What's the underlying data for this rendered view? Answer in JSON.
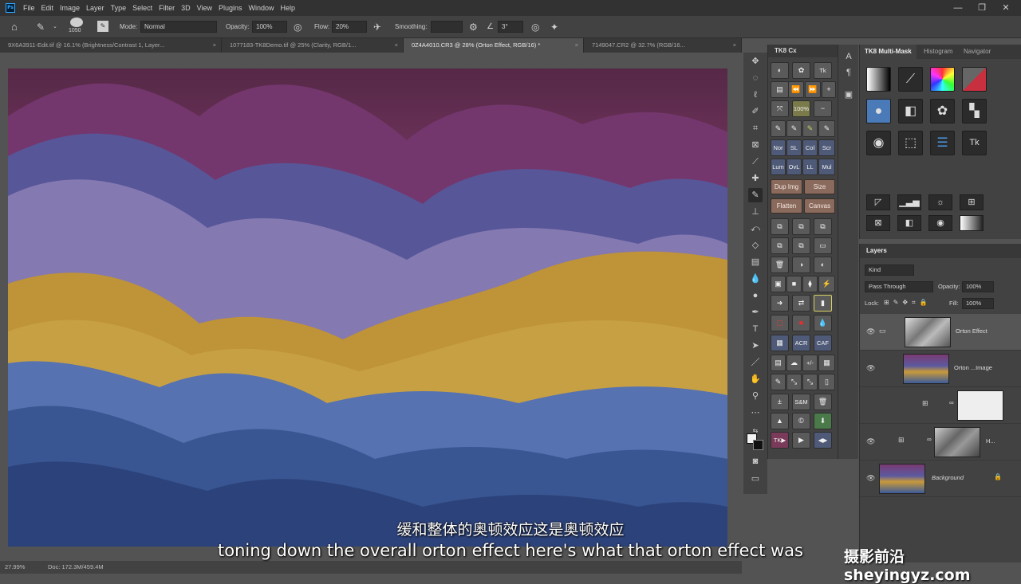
{
  "menu": {
    "app_icon": "Ps",
    "items": [
      "File",
      "Edit",
      "Image",
      "Layer",
      "Type",
      "Select",
      "Filter",
      "3D",
      "View",
      "Plugins",
      "Window",
      "Help"
    ],
    "window_controls": [
      "—",
      "❐",
      "✕"
    ]
  },
  "options": {
    "brush_size": "1050",
    "mode_label": "Mode:",
    "mode_value": "Normal",
    "opacity_label": "Opacity:",
    "opacity_value": "100%",
    "flow_label": "Flow:",
    "flow_value": "20%",
    "smoothing_label": "Smoothing:",
    "smoothing_value": "",
    "angle_value": "3°"
  },
  "tabs": [
    {
      "label": "9X6A3911-Edit.tif @ 16.1% (Brightness/Contrast 1, Layer...",
      "active": false
    },
    {
      "label": "1077183-TK8Demo.tif @ 25% (Clarity, RGB/1...",
      "active": false
    },
    {
      "label": "0Z4A4010.CR3 @ 28% (Orton Effect, RGB/16) *",
      "active": true
    },
    {
      "label": "7149047.CR2 @ 32.7% (RGB/16...",
      "active": false
    }
  ],
  "status": {
    "zoom": "27.99%",
    "doc": "Doc: 172.3M/459.4M"
  },
  "tk8": {
    "title": "TK8 Cx",
    "grid_rows": [
      [
        "◐",
        "✿",
        "Tk"
      ],
      [
        "▤",
        "⏪",
        "⏩",
        "+"
      ],
      [
        "⤧",
        "100%",
        "−"
      ],
      [
        "✎",
        "✎",
        "✎",
        "✎"
      ],
      [
        "Nor",
        "SL",
        "Col",
        "Scr"
      ],
      [
        "Lum",
        "OvL",
        "LL",
        "Mul"
      ],
      [
        "⧉",
        "⧉",
        "⧉"
      ],
      [
        "⧉",
        "⧉",
        "▭"
      ],
      [
        "🗑",
        "◑",
        "◐"
      ],
      [
        "▣",
        "■",
        "⧫",
        "⚡"
      ],
      [
        "➜",
        "⇄",
        "▮"
      ],
      [
        "▢",
        "■",
        "💧"
      ],
      [
        "▦",
        "ACR",
        "CAF"
      ],
      [
        "▤",
        "☁",
        "+/-",
        "▦"
      ],
      [
        "✎",
        "⤡",
        "⤡",
        "▯"
      ],
      [
        "±",
        "S&M",
        "🗑"
      ],
      [
        "▲",
        "©",
        "⬇"
      ],
      [
        "TK▶",
        "▶",
        "◀▶"
      ]
    ],
    "wide_buttons": [
      [
        "Dup Img",
        "Size"
      ],
      [
        "Flatten",
        "Canvas"
      ]
    ]
  },
  "multimask": {
    "tabs": [
      "TK8 Multi-Mask",
      "Histogram",
      "Navigator"
    ],
    "icons": [
      "gradient-bw-icon",
      "wand-mask-icon",
      "color-wheel-icon",
      "red-diagonal-icon",
      "person-mask-icon",
      "contrast-mask-icon",
      "flower-mask-icon",
      "checker-mask-icon",
      "dot-mask-icon",
      "selection-brush-icon",
      "list-icon",
      "tk-logo-icon"
    ],
    "small_icons": [
      "curves-icon",
      "levels-icon",
      "exposure-icon",
      "grid-icon",
      "mask-icon",
      "split-icon",
      "camera-icon",
      "gradient-icon"
    ]
  },
  "layers": {
    "title": "Layers",
    "kind": "Kind",
    "blend": "Pass Through",
    "opacity_label": "Opacity:",
    "opacity_value": "100%",
    "lock_label": "Lock:",
    "fill_label": "Fill:",
    "fill_value": "100%",
    "items": [
      {
        "name": "Orton Effect",
        "type": "group",
        "selected": true
      },
      {
        "name": "Orton ...Image",
        "type": "pixel",
        "selected": false
      },
      {
        "name": "",
        "type": "adjustment",
        "selected": false
      },
      {
        "name": "H...",
        "type": "adjustment",
        "selected": false
      },
      {
        "name": "Background",
        "type": "background",
        "selected": false
      }
    ]
  },
  "subtitles": {
    "cn": "缓和整体的奥顿效应这是奥顿效应",
    "en": "toning down the overall orton effect here's what that orton effect was"
  },
  "watermark": "摄影前沿 sheyingyz.com"
}
